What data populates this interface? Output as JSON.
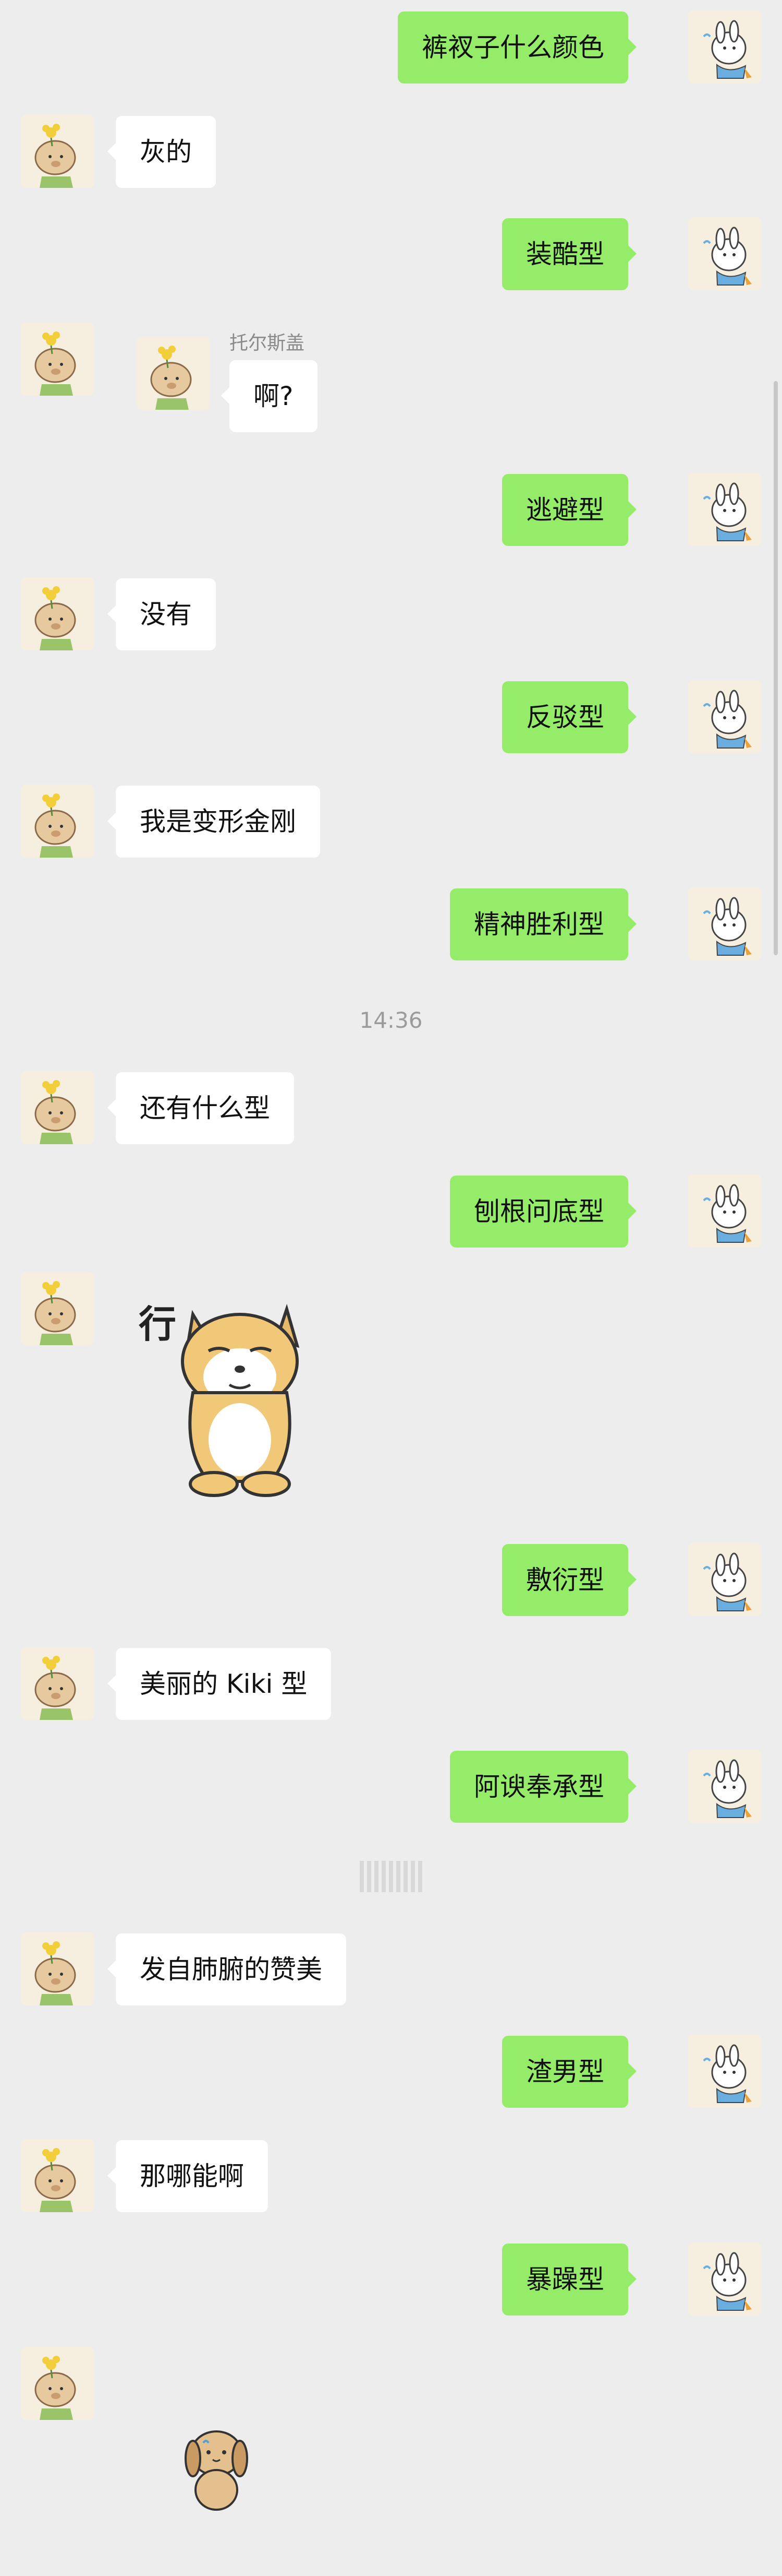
{
  "messages": [
    {
      "side": "me",
      "text": "裤衩子什么颜色"
    },
    {
      "side": "them",
      "text": "灰的"
    },
    {
      "side": "me",
      "text": "装酷型"
    },
    {
      "side": "them",
      "sender": "托尔斯盖",
      "text": "啊?"
    },
    {
      "side": "me",
      "text": "逃避型"
    },
    {
      "side": "them",
      "text": "没有"
    },
    {
      "side": "me",
      "text": "反驳型"
    },
    {
      "side": "them",
      "text": "我是变形金刚"
    },
    {
      "side": "me",
      "text": "精神胜利型"
    },
    {
      "timestamp": "14:36"
    },
    {
      "side": "them",
      "text": "还有什么型"
    },
    {
      "side": "me",
      "text": "刨根问底型"
    },
    {
      "side": "them",
      "sticker_text": "行"
    },
    {
      "side": "me",
      "text": "敷衍型"
    },
    {
      "side": "them",
      "text": "美丽的 Kiki 型"
    },
    {
      "side": "me",
      "text": "阿谀奉承型"
    },
    {
      "side": "them",
      "text": "发自肺腑的赞美"
    },
    {
      "side": "me",
      "text": "渣男型"
    },
    {
      "side": "them",
      "text": "那哪能啊"
    },
    {
      "side": "me",
      "text": "暴躁型"
    }
  ],
  "colors": {
    "background": "#ededed",
    "my_bubble": "#95ec69",
    "their_bubble": "#ffffff",
    "timestamp": "#9b9b9b"
  },
  "icons": {
    "me_avatar": "cartoon-rabbit-avatar",
    "them_avatar": "cartoon-bear-avatar",
    "sticker_1": "shiba-dog-sticker",
    "sticker_2": "puppy-sticker"
  }
}
